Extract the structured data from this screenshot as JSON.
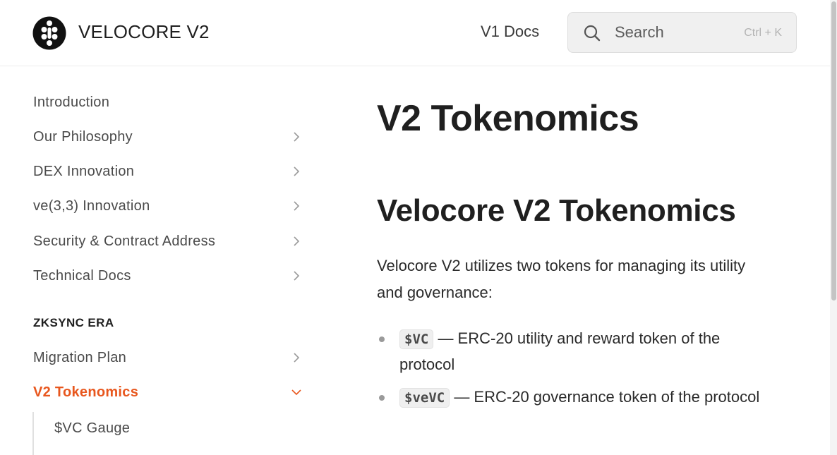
{
  "header": {
    "brand": "VELOCORE V2",
    "v1_docs": "V1 Docs",
    "search": {
      "placeholder": "Search",
      "shortcut": "Ctrl + K"
    }
  },
  "sidebar": {
    "items": [
      {
        "label": "Introduction"
      },
      {
        "label": "Our Philosophy"
      },
      {
        "label": "DEX Innovation"
      },
      {
        "label": "ve(3,3) Innovation"
      },
      {
        "label": "Security & Contract Address"
      },
      {
        "label": "Technical Docs"
      }
    ],
    "section_title": "ZKSYNC ERA",
    "section_items": [
      {
        "label": "Migration Plan"
      },
      {
        "label": "V2 Tokenomics"
      }
    ],
    "sub_items": [
      {
        "label": "$VC Gauge"
      }
    ]
  },
  "content": {
    "title": "V2 Tokenomics",
    "heading": "Velocore V2 Tokenomics",
    "intro": "Velocore V2 utilizes two tokens for managing its utility and governance:",
    "bullets": [
      {
        "code": "$VC",
        "text": " — ERC-20 utility and reward token of the protocol"
      },
      {
        "code": "$veVC",
        "text": " — ERC-20 governance token of the protocol"
      }
    ]
  },
  "colors": {
    "accent": "#e8571e",
    "text": "#1f1f1f",
    "muted": "#4a4a4a"
  }
}
